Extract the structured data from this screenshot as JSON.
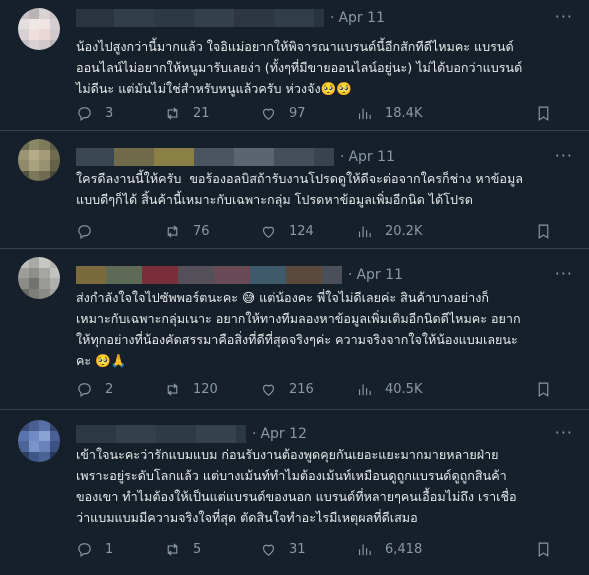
{
  "tweets": [
    {
      "time": "Apr 11",
      "more": "···",
      "text": "น้องไปสูงกว่านี้มากแล้ว ใจอิแม่อยากให้พิจารณาแบรนด์นี้อีกสักทีดีไหมคะ แบรนด์\nออนไลน์ไม่อยากให้หนูมารับเลยง่า (ทั้งๆที่มีขายออนไลน์อยู่นะ) ไม่ได้บอกว่าแบรนด์\nไม่ดีนะ แต่มันไม่ใช่สำหรับหนูแล้วครับ ห่วงจัง🥺🥺",
      "replies": "3",
      "retweets": "21",
      "likes": "97",
      "views": "18.4K"
    },
    {
      "time": "Apr 11",
      "more": "···",
      "text": "ใครดีลงานนี้ให้ครับ  ขอร้องอลบิสถ้ารับงานโปรดดูให้ดีจะต่อจากใครก็ช่าง หาข้อมูล\nแบบดีๆก็ได้ สิ้นค้านี้เหมาะกับเฉพาะกลุ่ม โปรดหาข้อมูลเพิ่มอีกนิด ได้โปรด",
      "replies": "",
      "retweets": "76",
      "likes": "124",
      "views": "20.2K"
    },
    {
      "time": "Apr 11",
      "more": "···",
      "text": "ส่งกำลังใจใจไปซัพพอร์ตนะคะ 😅 แต่น้องคะ พี่ใจไม่ดีเลยค่ะ สินค้าบางอย่างก็\nเหมาะกับเฉพาะกลุ่มเนาะ อยากให้ทางทีมลองหาข้อมูลเพิ่มเติมอีกนิดดีไหมคะ อยาก\nให้ทุกอย่างที่น้องคัดสรรมาคือสิ่งที่ดีที่สุดจริงๆค่ะ ความจริงจากใจให้น้องแบมเลยนะ\nคะ 🥺🙏",
      "replies": "2",
      "retweets": "120",
      "likes": "216",
      "views": "40.5K"
    },
    {
      "time": "Apr 12",
      "more": "···",
      "text": "เข้าใจนะคะว่ารักแบมแบม ก่อนรับงานต้องพูดคุยกันเยอะแยะมากมายหลายฝ่าย\nเพราะอยู่ระดับโลกแล้ว แต่บางเม้นท์ทำไมต้องเม้นท์เหมือนดูถูกแบรนด์ดูถูกสินค้า\nของเขา ทำไมต้องให้เป็นแต่แบรนด์ของนอก แบรนด์ที่หลายๆคนเอื้อมไม่ถึง เราเชื่อ\nว่าแบมแบมมีความจริงใจที่สุด ตัดสินใจทำอะไรมีเหตุผลที่ดีเสมอ",
      "replies": "1",
      "retweets": "5",
      "likes": "31",
      "views": "6,418"
    }
  ],
  "icons": [
    "more-icon",
    "reply-icon",
    "retweet-icon",
    "like-icon",
    "views-icon",
    "bookmark-icon"
  ],
  "colors": {
    "background": "#15202b",
    "text": "#e7e9ea",
    "muted": "#8b98a5",
    "divider": "#38444d"
  }
}
